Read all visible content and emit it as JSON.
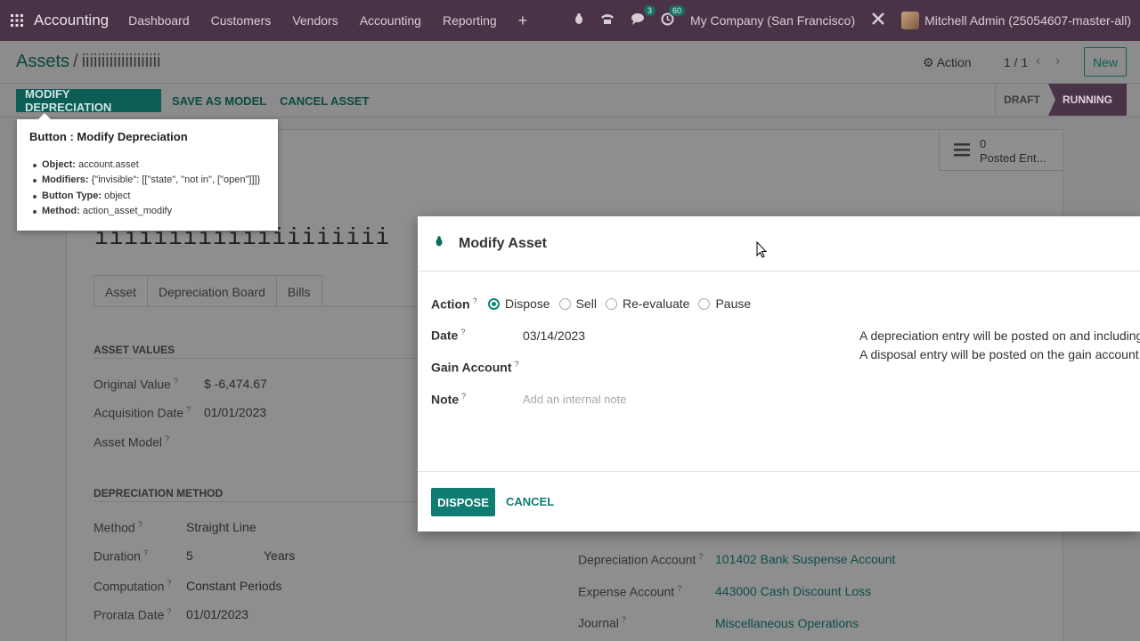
{
  "navbar": {
    "app_name": "Accounting",
    "menus": [
      "Dashboard",
      "Customers",
      "Vendors",
      "Accounting",
      "Reporting"
    ],
    "messages_count": "3",
    "activities_count": "60",
    "company": "My Company (San Francisco)",
    "user": "Mitchell Admin (25054607-master-all)"
  },
  "control_panel": {
    "breadcrumb_parent": "Assets",
    "breadcrumb_sep": "/",
    "breadcrumb_current": "iiiiiiiiiiiiiiiiiiii",
    "action_label": "Action",
    "pager": "1 / 1",
    "new_label": "New"
  },
  "header_buttons": {
    "modify": "MODIFY DEPRECIATION",
    "save_model": "SAVE AS MODEL",
    "cancel_asset": "CANCEL ASSET"
  },
  "statusbar": {
    "draft": "DRAFT",
    "running": "RUNNING"
  },
  "smart_button": {
    "count": "0",
    "label": "Posted Ent..."
  },
  "form": {
    "asset_name": "iiiiiiiiiiiiiiiiiiii",
    "tabs": [
      "Asset",
      "Depreciation Board",
      "Bills"
    ],
    "asset_values_title": "ASSET VALUES",
    "original_value_label": "Original Value",
    "original_value": "$ -6,474.67",
    "acquisition_date_label": "Acquisition Date",
    "acquisition_date": "01/01/2023",
    "asset_model_label": "Asset Model",
    "depreciation_method_title": "DEPRECIATION METHOD",
    "method_label": "Method",
    "method": "Straight Line",
    "duration_label": "Duration",
    "duration": "5",
    "duration_unit": "Years",
    "computation_label": "Computation",
    "computation": "Constant Periods",
    "prorata_label": "Prorata Date",
    "prorata": "01/01/2023",
    "depreciation_account_label": "Depreciation Account",
    "depreciation_account": "101402 Bank Suspense Account",
    "expense_account_label": "Expense Account",
    "expense_account": "443000 Cash Discount Loss",
    "journal_label": "Journal",
    "journal": "Miscellaneous Operations"
  },
  "tooltip": {
    "title": "Button : Modify Depreciation",
    "object_key": "Object:",
    "object_val": "account.asset",
    "modifiers_key": "Modifiers:",
    "modifiers_val": "{\"invisible\": [[\"state\", \"not in\", [\"open\"]]]}",
    "type_key": "Button Type:",
    "type_val": "object",
    "method_key": "Method:",
    "method_val": "action_asset_modify"
  },
  "modal": {
    "title": "Modify Asset",
    "action_label": "Action",
    "options": [
      "Dispose",
      "Sell",
      "Re-evaluate",
      "Pause"
    ],
    "selected": "Dispose",
    "date_label": "Date",
    "date_value": "03/14/2023",
    "gain_label": "Gain Account",
    "note_label": "Note",
    "note_placeholder": "Add an internal note",
    "info_line1": "A depreciation entry will be posted on and including th",
    "info_line2": "A disposal entry will be posted on the gain account .",
    "dispose_button": "DISPOSE",
    "cancel_button": "CANCEL",
    "help_mark": "?"
  },
  "icons": [
    "apps-grid-icon",
    "bug-icon",
    "phone-icon",
    "chat-icon",
    "clock-icon",
    "tools-icon",
    "gear-icon",
    "list-icon"
  ]
}
